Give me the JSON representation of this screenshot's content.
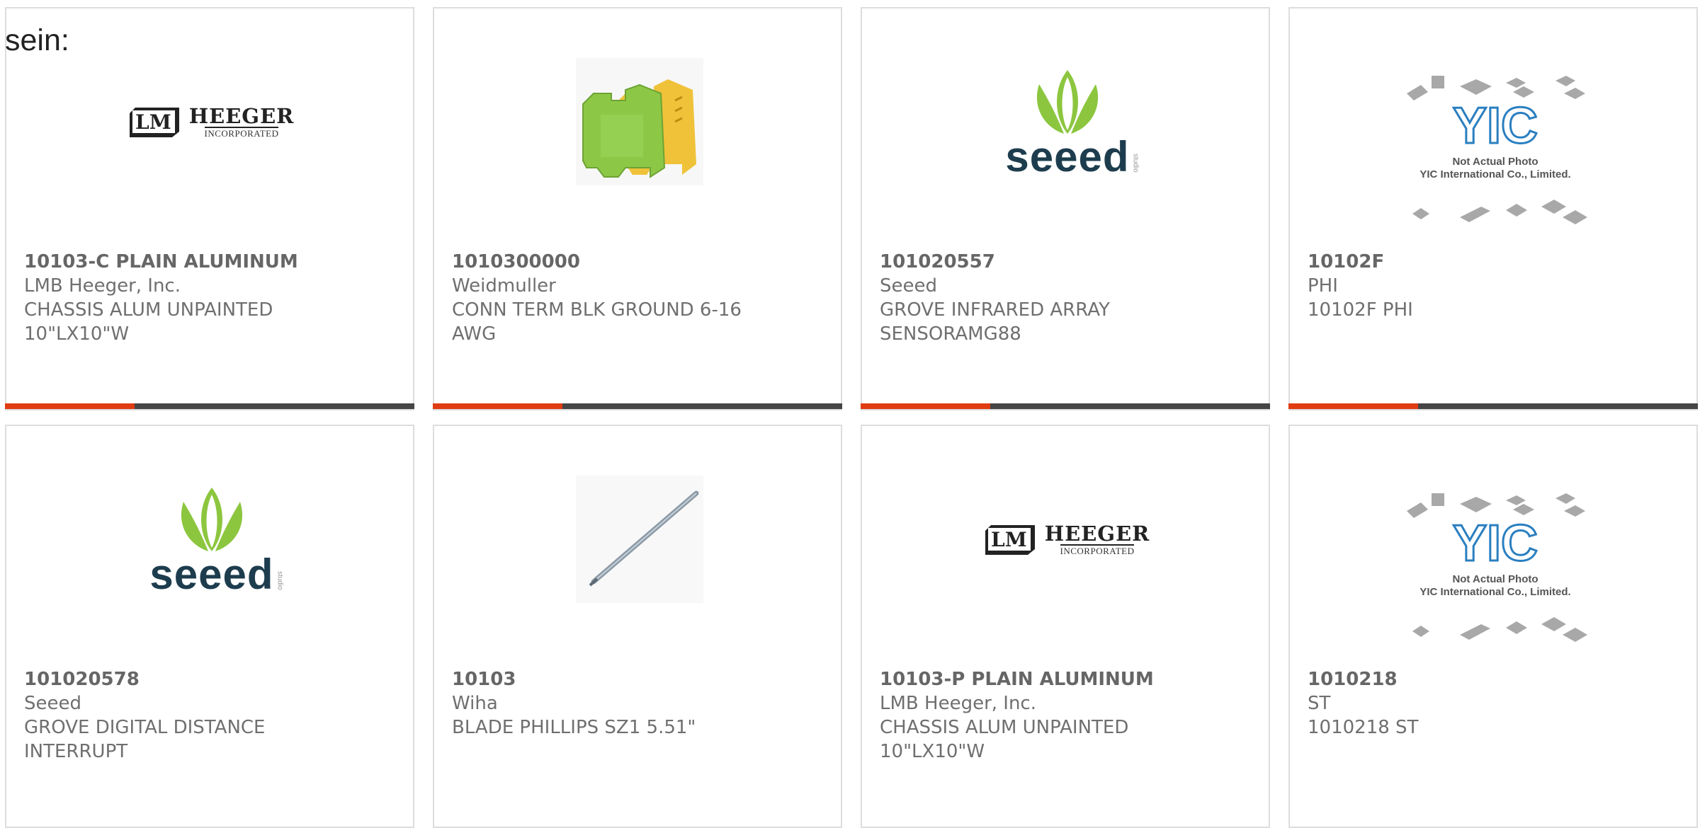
{
  "page": {
    "prefix_text": "sein:"
  },
  "products": [
    {
      "part_number": "10103-C PLAIN ALUMINUM",
      "manufacturer": "LMB Heeger, Inc.",
      "description": "CHASSIS ALUM UNPAINTED 10\"LX10\"W",
      "image": "heeger-logo",
      "logo_name": "HEEGER",
      "logo_sub": "INCORPORATED"
    },
    {
      "part_number": "1010300000",
      "manufacturer": "Weidmuller",
      "description": "CONN TERM BLK GROUND 6-16 AWG",
      "image": "terminal-block-photo"
    },
    {
      "part_number": "101020557",
      "manufacturer": "Seeed",
      "description": "GROVE INFRARED ARRAY SENSORAMG88",
      "image": "seeed-logo",
      "logo_word": "seeed",
      "logo_sub": "studio"
    },
    {
      "part_number": "10102F",
      "manufacturer": "PHI",
      "description": "10102F PHI",
      "image": "yic-placeholder",
      "placeholder_line1": "Not Actual Photo",
      "placeholder_line2": "YIC International Co., Limited."
    },
    {
      "part_number": "101020578",
      "manufacturer": "Seeed",
      "description": "GROVE DIGITAL DISTANCE INTERRUPT",
      "image": "seeed-logo",
      "logo_word": "seeed",
      "logo_sub": "studio"
    },
    {
      "part_number": "10103",
      "manufacturer": "Wiha",
      "description": "BLADE PHILLIPS SZ1 5.51\"",
      "image": "screwdriver-blade-photo"
    },
    {
      "part_number": "10103-P PLAIN ALUMINUM",
      "manufacturer": "LMB Heeger, Inc.",
      "description": "CHASSIS ALUM UNPAINTED 10\"LX10\"W",
      "image": "heeger-logo",
      "logo_name": "HEEGER",
      "logo_sub": "INCORPORATED"
    },
    {
      "part_number": "1010218",
      "manufacturer": "ST",
      "description": "1010218 ST",
      "image": "yic-placeholder",
      "placeholder_line1": "Not Actual Photo",
      "placeholder_line2": "YIC International Co., Limited."
    }
  ],
  "colors": {
    "accent": "#e03c12",
    "bar": "#454545",
    "card_border": "#dddddd",
    "text": "#6f6f6f",
    "seeed_green": "#8cc63f",
    "seeed_navy": "#1d3d4e",
    "yic_blue": "#2a7fc0"
  }
}
